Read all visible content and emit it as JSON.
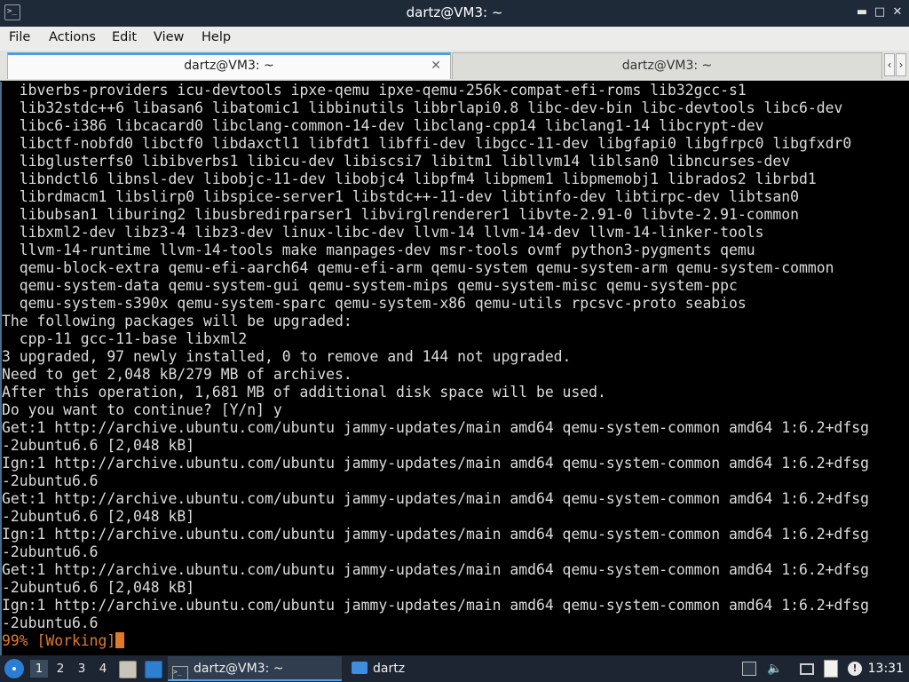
{
  "window": {
    "title": "dartz@VM3: ~",
    "app_icon": "terminal-icon",
    "buttons": [
      "minimize-icon",
      "maximize-icon",
      "close-icon"
    ]
  },
  "menu": {
    "items": [
      "File",
      "Actions",
      "Edit",
      "View",
      "Help"
    ]
  },
  "tabs": [
    {
      "label": "dartz@VM3: ~",
      "active": true
    },
    {
      "label": "dartz@VM3: ~",
      "active": false
    }
  ],
  "terminal": {
    "lines": [
      "  ibverbs-providers icu-devtools ipxe-qemu ipxe-qemu-256k-compat-efi-roms lib32gcc-s1",
      "  lib32stdc++6 libasan6 libatomic1 libbinutils libbrlapi0.8 libc-dev-bin libc-devtools libc6-dev",
      "  libc6-i386 libcacard0 libclang-common-14-dev libclang-cpp14 libclang1-14 libcrypt-dev",
      "  libctf-nobfd0 libctf0 libdaxctl1 libfdt1 libffi-dev libgcc-11-dev libgfapi0 libgfrpc0 libgfxdr0",
      "  libglusterfs0 libibverbs1 libicu-dev libiscsi7 libitm1 libllvm14 liblsan0 libncurses-dev",
      "  libndctl6 libnsl-dev libobjc-11-dev libobjc4 libpfm4 libpmem1 libpmemobj1 librados2 librbd1",
      "  librdmacm1 libslirp0 libspice-server1 libstdc++-11-dev libtinfo-dev libtirpc-dev libtsan0",
      "  libubsan1 liburing2 libusbredirparser1 libvirglrenderer1 libvte-2.91-0 libvte-2.91-common",
      "  libxml2-dev libz3-4 libz3-dev linux-libc-dev llvm-14 llvm-14-dev llvm-14-linker-tools",
      "  llvm-14-runtime llvm-14-tools make manpages-dev msr-tools ovmf python3-pygments qemu",
      "  qemu-block-extra qemu-efi-aarch64 qemu-efi-arm qemu-system qemu-system-arm qemu-system-common",
      "  qemu-system-data qemu-system-gui qemu-system-mips qemu-system-misc qemu-system-ppc",
      "  qemu-system-s390x qemu-system-sparc qemu-system-x86 qemu-utils rpcsvc-proto seabios",
      "The following packages will be upgraded:",
      "  cpp-11 gcc-11-base libxml2",
      "3 upgraded, 97 newly installed, 0 to remove and 144 not upgraded.",
      "Need to get 2,048 kB/279 MB of archives.",
      "After this operation, 1,681 MB of additional disk space will be used.",
      "Do you want to continue? [Y/n] y",
      "Get:1 http://archive.ubuntu.com/ubuntu jammy-updates/main amd64 qemu-system-common amd64 1:6.2+dfsg",
      "-2ubuntu6.6 [2,048 kB]",
      "Ign:1 http://archive.ubuntu.com/ubuntu jammy-updates/main amd64 qemu-system-common amd64 1:6.2+dfsg",
      "-2ubuntu6.6",
      "Get:1 http://archive.ubuntu.com/ubuntu jammy-updates/main amd64 qemu-system-common amd64 1:6.2+dfsg",
      "-2ubuntu6.6 [2,048 kB]",
      "Ign:1 http://archive.ubuntu.com/ubuntu jammy-updates/main amd64 qemu-system-common amd64 1:6.2+dfsg",
      "-2ubuntu6.6",
      "Get:1 http://archive.ubuntu.com/ubuntu jammy-updates/main amd64 qemu-system-common amd64 1:6.2+dfsg",
      "-2ubuntu6.6 [2,048 kB]",
      "Ign:1 http://archive.ubuntu.com/ubuntu jammy-updates/main amd64 qemu-system-common amd64 1:6.2+dfsg",
      "-2ubuntu6.6"
    ],
    "progress_line": "99% [Working]",
    "text_color": "#dcdcdc",
    "progress_color": "#e07a2a"
  },
  "taskbar": {
    "start_icon": "lxqt-start-icon",
    "workspaces": [
      "1",
      "2",
      "3",
      "4"
    ],
    "active_workspace": "1",
    "quicklaunch": [
      "file-manager-icon",
      "show-desktop-icon"
    ],
    "tasks": [
      {
        "label": "dartz@VM3: ~",
        "icon": "terminal-icon",
        "active": true
      },
      {
        "label": "dartz",
        "icon": "folder-icon",
        "active": false
      }
    ],
    "tray": [
      "network-icon",
      "volume-icon",
      "display-icon",
      "clipboard-icon",
      "update-notifier-icon"
    ],
    "clock": "13:31"
  }
}
